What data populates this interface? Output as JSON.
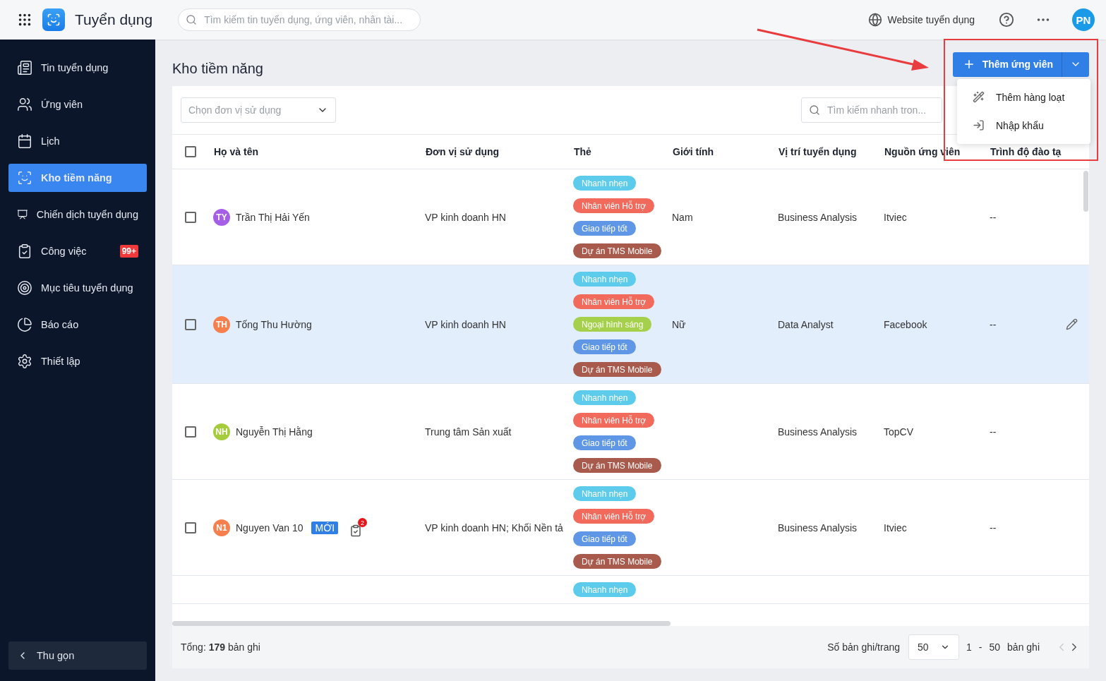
{
  "topbar": {
    "app_name": "Tuyển dụng",
    "search_placeholder": "Tìm kiếm tin tuyển dụng, ứng viên, nhân tài...",
    "website_link": "Website tuyển dụng",
    "avatar_initials": "PN"
  },
  "sidebar": {
    "items": [
      {
        "kind": "news",
        "label": "Tin tuyển dụng",
        "selected": false
      },
      {
        "kind": "users",
        "label": "Ứng viên",
        "selected": false
      },
      {
        "kind": "calendar",
        "label": "Lịch",
        "selected": false
      },
      {
        "kind": "talent",
        "label": "Kho tiềm năng",
        "selected": true
      },
      {
        "kind": "campaign",
        "label": "Chiến dịch tuyển dụng",
        "selected": false
      },
      {
        "kind": "task",
        "label": "Công việc",
        "selected": false,
        "badge": "99+"
      },
      {
        "kind": "target",
        "label": "Mục tiêu tuyển dụng",
        "selected": false
      },
      {
        "kind": "report",
        "label": "Báo cáo",
        "selected": false
      },
      {
        "kind": "settings",
        "label": "Thiết lập",
        "selected": false
      }
    ],
    "collapse_label": "Thu gọn"
  },
  "page_title": "Kho tiềm năng",
  "add_button": {
    "label": "Thêm ứng viên",
    "menu_open": true,
    "menu": [
      {
        "kind": "bulk",
        "label": "Thêm hàng loạt"
      },
      {
        "kind": "import",
        "label": "Nhập khẩu"
      }
    ]
  },
  "filter": {
    "unit_placeholder": "Chọn đơn vị sử dụng",
    "search_placeholder": "Tìm kiếm nhanh tron..."
  },
  "table": {
    "select_all_checked": false,
    "columns": [
      "Họ và tên",
      "Đơn vị sử dụng",
      "Thẻ",
      "Giới tính",
      "Vị trí tuyển dụng",
      "Nguồn ứng viên",
      "Trình độ đào tạ"
    ],
    "rows": [
      {
        "checked": false,
        "selected": false,
        "initials": "TY",
        "color": "#a55ee6",
        "name": "Trần Thị Hải Yến",
        "unit": "VP kinh doanh HN",
        "tags": [
          {
            "label": "Nhanh nhẹn",
            "color": "#5ccbec"
          },
          {
            "label": "Nhân viên Hỗ trợ",
            "color": "#f26a5b"
          },
          {
            "label": "Giao tiếp tốt",
            "color": "#5f97e6"
          },
          {
            "label": "Dự án TMS Mobile",
            "color": "#a85a4c"
          }
        ],
        "gender": "Nam",
        "position": "Business Analysis",
        "source": "Itviec",
        "education": "--"
      },
      {
        "checked": false,
        "selected": true,
        "initials": "TH",
        "color": "#f5804e",
        "name": "Tống Thu Hường",
        "unit": "VP kinh doanh HN",
        "tags": [
          {
            "label": "Nhanh nhẹn",
            "color": "#5ccbec"
          },
          {
            "label": "Nhân viên Hỗ trợ",
            "color": "#f26a5b"
          },
          {
            "label": "Ngoại hình sáng",
            "color": "#a5d04c"
          },
          {
            "label": "Giao tiếp tốt",
            "color": "#5f97e6"
          },
          {
            "label": "Dự án TMS Mobile",
            "color": "#a85a4c"
          }
        ],
        "gender": "Nữ",
        "position": "Data Analyst",
        "source": "Facebook",
        "education": "--"
      },
      {
        "checked": false,
        "selected": false,
        "initials": "NH",
        "color": "#a5cc3c",
        "name": "Nguyễn Thị Hằng",
        "unit": "Trung tâm Sản xuất",
        "tags": [
          {
            "label": "Nhanh nhẹn",
            "color": "#5ccbec"
          },
          {
            "label": "Nhân viên Hỗ trợ",
            "color": "#f26a5b"
          },
          {
            "label": "Giao tiếp tốt",
            "color": "#5f97e6"
          },
          {
            "label": "Dự án TMS Mobile",
            "color": "#a85a4c"
          }
        ],
        "position": "Business Analysis",
        "source": "TopCV",
        "education": "--"
      },
      {
        "checked": false,
        "selected": false,
        "initials": "N1",
        "color": "#f5804e",
        "name": "Nguyen Van 10",
        "new_badge": "MỚI",
        "task_count": "2",
        "unit": "VP kinh doanh HN; Khối Nền tả",
        "tags": [
          {
            "label": "Nhanh nhẹn",
            "color": "#5ccbec"
          },
          {
            "label": "Nhân viên Hỗ trợ",
            "color": "#f26a5b"
          },
          {
            "label": "Giao tiếp tốt",
            "color": "#5f97e6"
          },
          {
            "label": "Dự án TMS Mobile",
            "color": "#a85a4c"
          }
        ],
        "position": "Business Analysis",
        "source": "Itviec",
        "education": "--"
      },
      {
        "partial": true,
        "tags": [
          {
            "label": "Nhanh nhẹn",
            "color": "#5ccbec"
          }
        ]
      }
    ]
  },
  "footer": {
    "total": "Tổng: **179** bản ghi",
    "page_size_label": "Số bản ghi/trang",
    "page_size": "50",
    "range_start": "1",
    "range_sep": "-",
    "range_end": "50",
    "range_unit": "bản ghi"
  }
}
